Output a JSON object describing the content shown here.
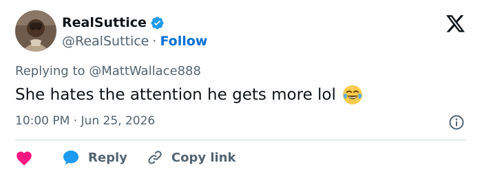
{
  "author": {
    "display_name": "RealSuttice",
    "handle": "@RealSuttice",
    "separator": "·",
    "follow_label": "Follow",
    "verified": true,
    "avatar_icon": "avatar-photo"
  },
  "reply_context": {
    "prefix": "Replying to",
    "mention": "@MattWallace888"
  },
  "tweet": {
    "text": "She hates the attention he gets more lol",
    "emoji": "face-with-tears-of-joy"
  },
  "timestamp": {
    "time": "10:00 PM",
    "separator": "·",
    "date": "Jun 25, 2026"
  },
  "actions": {
    "like_icon": "heart-icon",
    "reply_label": "Reply",
    "copy_label": "Copy link"
  },
  "colors": {
    "accent": "#006fd6",
    "verified": "#1d9bf0",
    "like": "#f91880",
    "secondary_text": "#536471",
    "divider": "#cfd9de"
  }
}
